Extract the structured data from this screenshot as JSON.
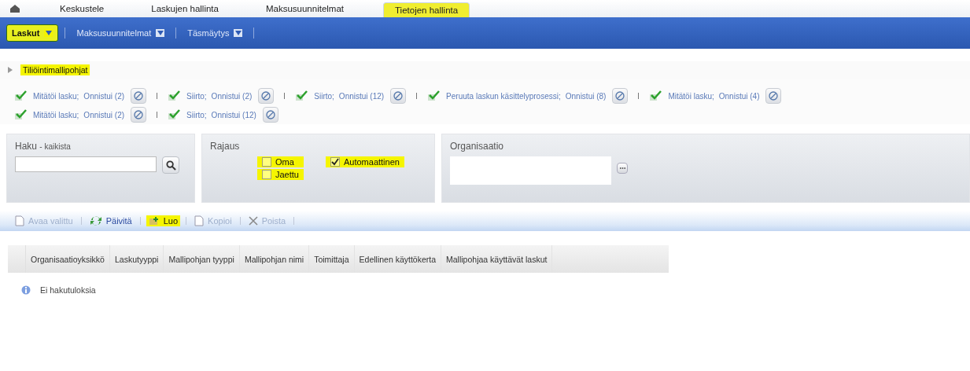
{
  "top_tabs": [
    {
      "label": "Keskustele",
      "selected": false,
      "highlighted": false
    },
    {
      "label": "Laskujen hallinta",
      "selected": false,
      "highlighted": false
    },
    {
      "label": "Maksusuunnitelmat",
      "selected": false,
      "highlighted": false
    },
    {
      "label": "Tietojen hallinta",
      "selected": true,
      "highlighted": true
    }
  ],
  "nav": [
    {
      "label": "Laskut",
      "selected": true,
      "highlighted": true
    },
    {
      "label": "Maksusuunnitelmat",
      "selected": false,
      "highlighted": false
    },
    {
      "label": "Täsmäytys",
      "selected": false,
      "highlighted": false
    }
  ],
  "breadcrumb": {
    "label": "Tiliöintimallipohjat",
    "highlighted": true
  },
  "notifications": [
    [
      {
        "action": "Mitätöi lasku;",
        "result": "Onnistui (2)"
      },
      {
        "action": "Siirto;",
        "result": "Onnistui (2)"
      },
      {
        "action": "Siirto;",
        "result": "Onnistui (12)"
      },
      {
        "action": "Peruuta laskun käsittelyprosessi;",
        "result": "Onnistui (8)"
      },
      {
        "action": "Mitätöi lasku;",
        "result": "Onnistui (4)"
      }
    ],
    [
      {
        "action": "Mitätöi lasku;",
        "result": "Onnistui (2)"
      },
      {
        "action": "Siirto;",
        "result": "Onnistui (12)"
      }
    ]
  ],
  "search": {
    "title": "Haku",
    "subtitle": "- kaikista"
  },
  "filter": {
    "title": "Rajaus",
    "options": [
      {
        "label": "Oma",
        "checked": false,
        "highlighted": true
      },
      {
        "label": "Automaattinen",
        "checked": true,
        "highlighted": true
      },
      {
        "label": "Jaettu",
        "checked": false,
        "highlighted": true
      }
    ]
  },
  "organisation": {
    "title": "Organisaatio"
  },
  "toolbar": [
    {
      "kind": "open",
      "label": "Avaa valittu",
      "disabled": true,
      "highlighted": false
    },
    {
      "kind": "refresh",
      "label": "Päivitä",
      "disabled": false,
      "highlighted": false
    },
    {
      "kind": "create",
      "label": "Luo",
      "disabled": false,
      "highlighted": true
    },
    {
      "kind": "copy",
      "label": "Kopioi",
      "disabled": true,
      "highlighted": false
    },
    {
      "kind": "delete",
      "label": "Poista",
      "disabled": true,
      "highlighted": false
    }
  ],
  "table": {
    "columns": [
      "Organisaatioyksikkö",
      "Laskutyyppi",
      "Mallipohjan tyyppi",
      "Mallipohjan nimi",
      "Toimittaja",
      "Edellinen käyttökerta",
      "Mallipohjaa käyttävät laskut"
    ]
  },
  "empty_message": "Ei hakutuloksia"
}
